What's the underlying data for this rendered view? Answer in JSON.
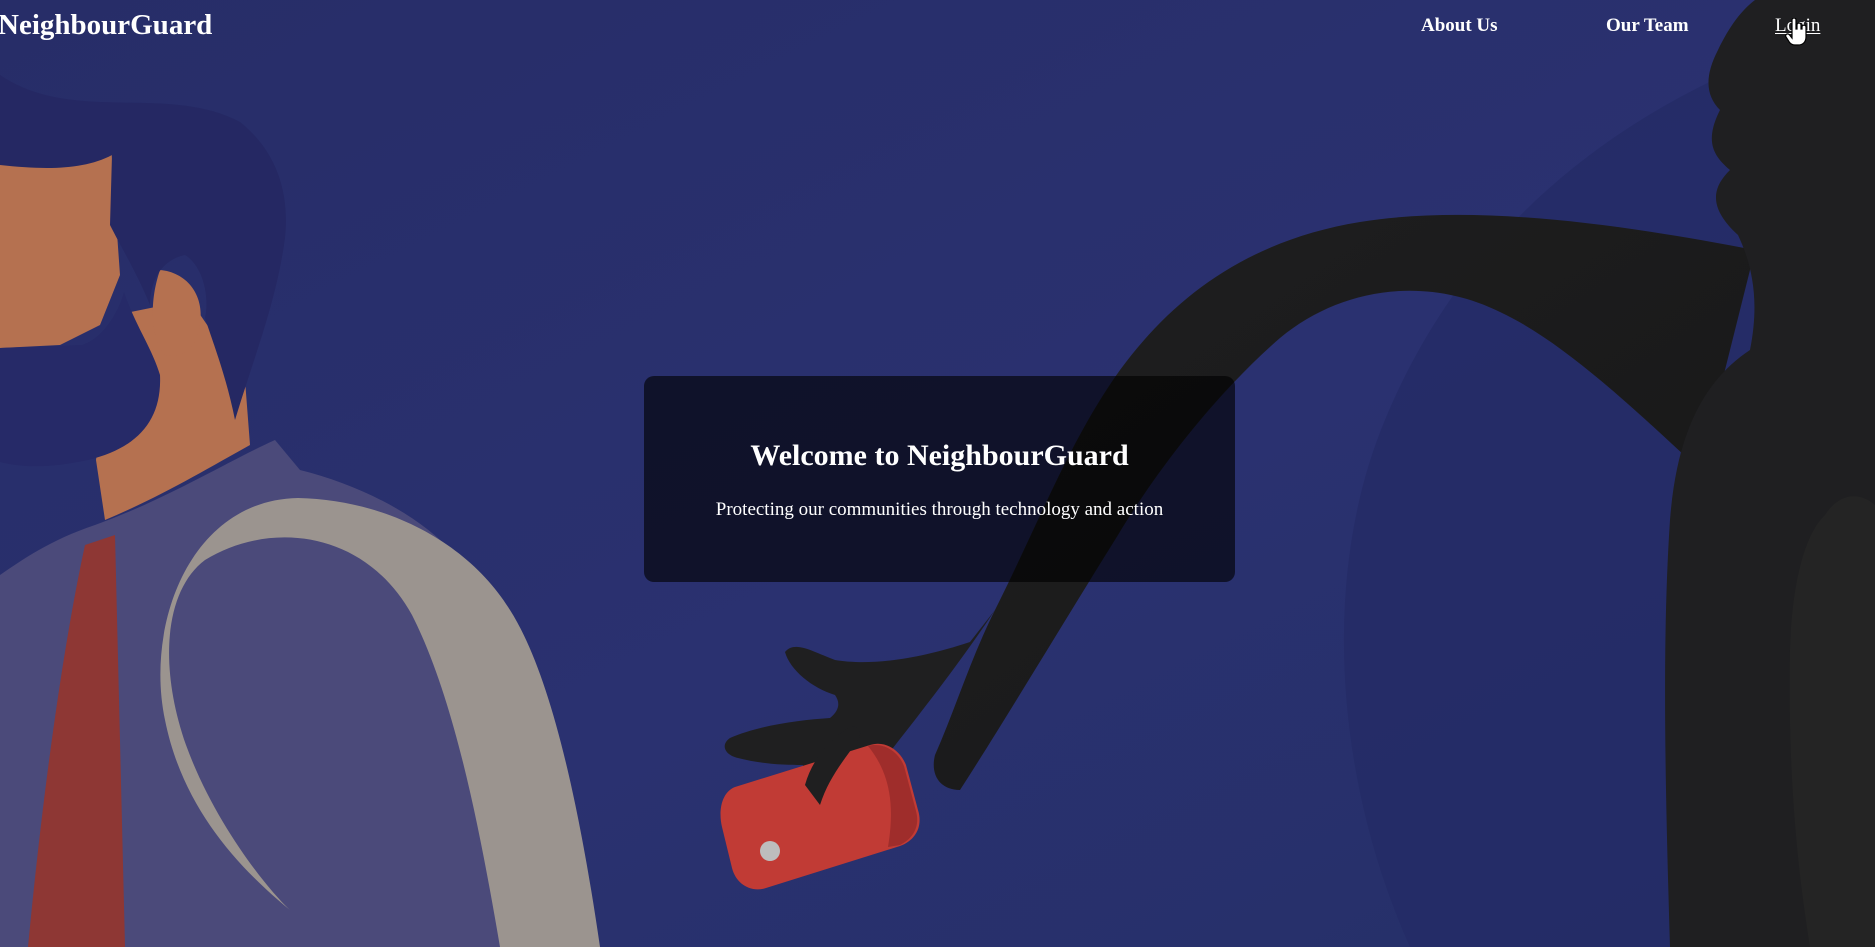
{
  "navbar": {
    "brand": "NeighbourGuard",
    "links": {
      "about": "About Us",
      "team": "Our Team",
      "login": "Login"
    }
  },
  "hero": {
    "title": "Welcome to NeighbourGuard",
    "subtitle": "Protecting our communities through technology and action"
  },
  "colors": {
    "background": "#2a3170",
    "card_overlay": "#000000",
    "text": "#ffffff",
    "phone": "#c13b35",
    "shadow_figure": "#202020"
  },
  "icons": {
    "cursor": "hand-pointer-icon"
  }
}
